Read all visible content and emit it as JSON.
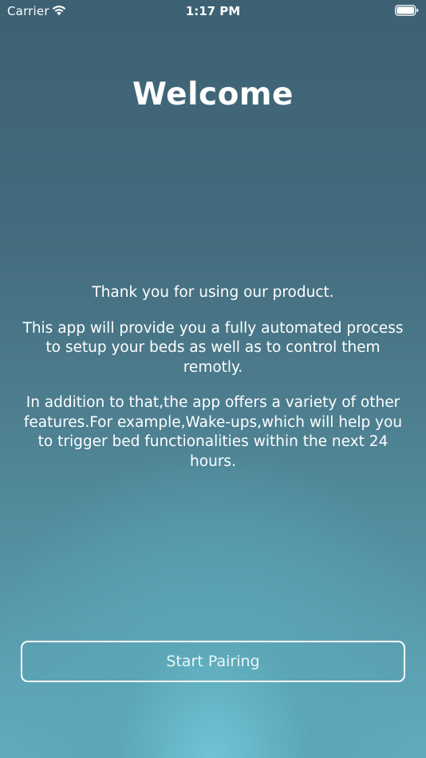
{
  "status_bar": {
    "carrier": "Carrier",
    "time": "1:17 PM",
    "wifi_icon": "wifi-icon",
    "battery_icon": "battery-icon"
  },
  "title": "Welcome",
  "paragraphs": [
    "Thank you for using our product.",
    "This app will provide you a fully automated process to setup your beds as well as to control them remotly.",
    "In addition to that,the app offers a variety of other features.For example,Wake-ups,which will help you to trigger bed functionalities within the next 24 hours."
  ],
  "button": {
    "label": "Start Pairing"
  },
  "colors": {
    "background_top": "#3d6173",
    "background_bottom": "#6fc4d6",
    "text": "#ffffff"
  }
}
